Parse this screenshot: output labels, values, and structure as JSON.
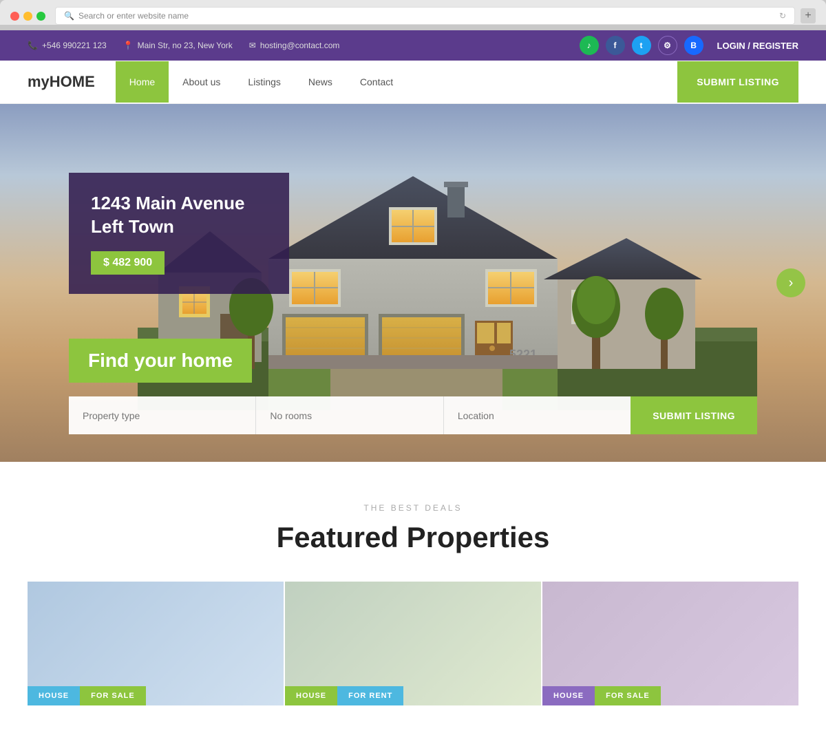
{
  "browser": {
    "address_bar_placeholder": "Search or enter website name"
  },
  "top_bar": {
    "phone": "+546 990221 123",
    "address": "Main Str, no 23, New York",
    "email": "hosting@contact.com",
    "login_register": "LOGIN / REGISTER",
    "social_icons": [
      {
        "name": "spotify",
        "symbol": "♪"
      },
      {
        "name": "facebook",
        "symbol": "f"
      },
      {
        "name": "twitter",
        "symbol": "t"
      },
      {
        "name": "settings",
        "symbol": "⚙"
      },
      {
        "name": "behance",
        "symbol": "B"
      }
    ]
  },
  "nav": {
    "logo_my": "my",
    "logo_home": "HOME",
    "links": [
      {
        "label": "Home",
        "active": true
      },
      {
        "label": "About us",
        "active": false
      },
      {
        "label": "Listings",
        "active": false
      },
      {
        "label": "News",
        "active": false
      },
      {
        "label": "Contact",
        "active": false
      }
    ],
    "submit_listing": "SUBMIT LISTING"
  },
  "hero": {
    "property_title": "1243 Main Avenue Left Town",
    "property_price": "$ 482 900",
    "find_home": "Find your home",
    "search": {
      "property_type": "Property type",
      "no_rooms": "No rooms",
      "location": "Location",
      "submit": "SUBMIT LISTING"
    },
    "arrow": "›"
  },
  "featured": {
    "subtitle": "THE BEST DEALS",
    "title": "Featured Properties",
    "cards": [
      {
        "type": "HOUSE",
        "status": "FOR SALE",
        "type_color": "blue",
        "status_color": "green"
      },
      {
        "type": "HOUSE",
        "status": "FOR RENT",
        "type_color": "green",
        "status_color": "blue"
      },
      {
        "type": "HOUSE",
        "status": "FOR SALE",
        "type_color": "purple",
        "status_color": "green"
      }
    ]
  }
}
